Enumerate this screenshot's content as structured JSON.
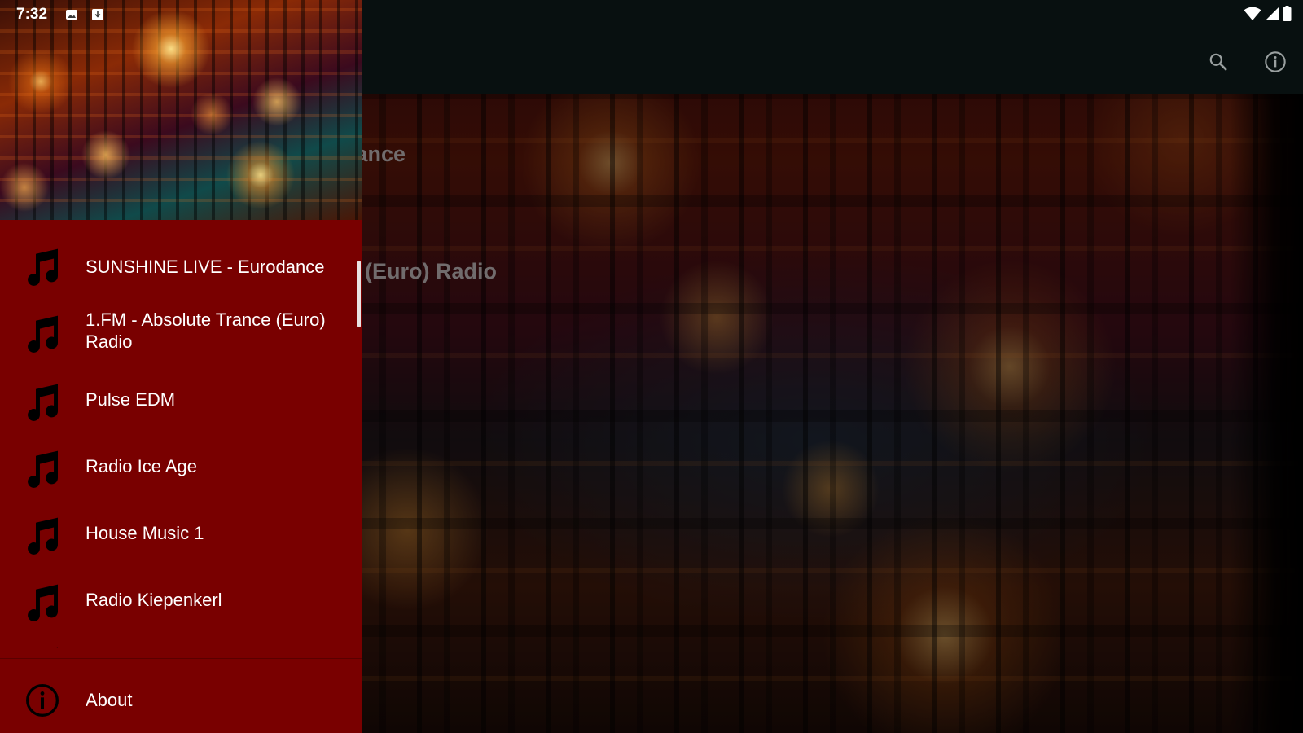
{
  "status_bar": {
    "time": "7:32",
    "notification_icons": [
      "image-notification-icon",
      "download-notification-icon"
    ],
    "indicator_icons": [
      "wifi-icon",
      "cellular-signal-icon",
      "battery-icon"
    ]
  },
  "toolbar": {
    "actions": [
      "search-icon",
      "info-icon"
    ]
  },
  "main": {
    "visible_fragments": [
      "dance",
      "(Euro) Radio"
    ]
  },
  "drawer": {
    "items": [
      {
        "label": "SUNSHINE LIVE - Eurodance",
        "icon": "music-note-icon"
      },
      {
        "label": "1.FM - Absolute Trance (Euro) Radio",
        "icon": "music-note-icon"
      },
      {
        "label": "Pulse EDM",
        "icon": "music-note-icon"
      },
      {
        "label": "Radio Ice Age",
        "icon": "music-note-icon"
      },
      {
        "label": "House Music 1",
        "icon": "music-note-icon"
      },
      {
        "label": "Radio Kiepenkerl",
        "icon": "music-note-icon"
      }
    ],
    "about": {
      "label": "About",
      "icon": "info-outline-icon"
    }
  },
  "colors": {
    "drawer_background": "#790000",
    "toolbar_background": "#081010",
    "text_primary": "#ffffff",
    "main_text_dimmed": "#b7aeb0"
  }
}
